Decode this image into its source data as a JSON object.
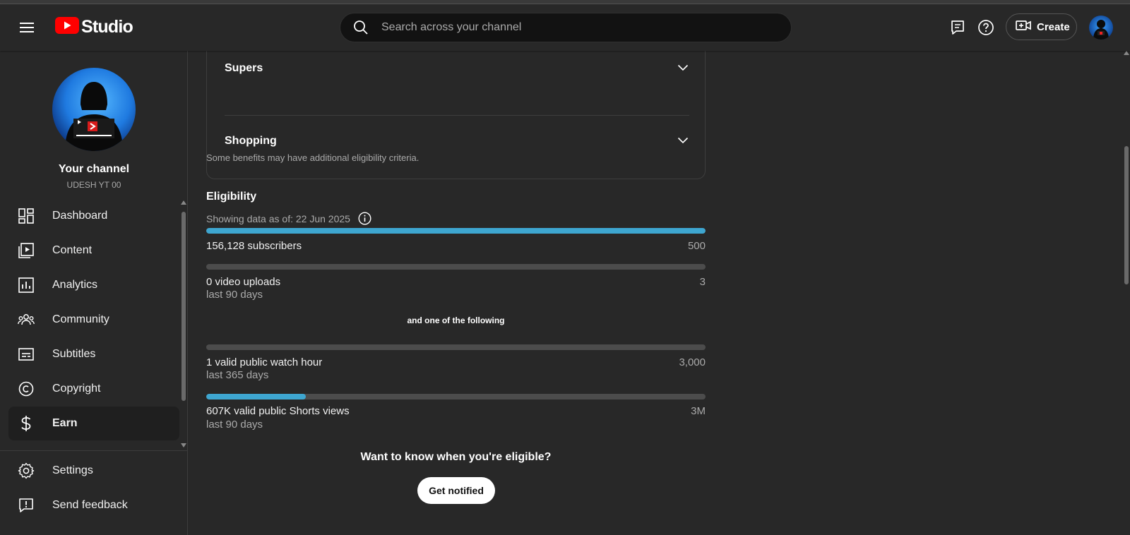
{
  "header": {
    "app_name": "Studio",
    "search_placeholder": "Search across your channel",
    "create_label": "Create"
  },
  "sidebar": {
    "channel_title": "Your channel",
    "channel_name": "UDESH YT 00",
    "items": [
      {
        "label": "Dashboard",
        "icon": "dashboard-icon"
      },
      {
        "label": "Content",
        "icon": "content-icon"
      },
      {
        "label": "Analytics",
        "icon": "analytics-icon"
      },
      {
        "label": "Community",
        "icon": "community-icon"
      },
      {
        "label": "Subtitles",
        "icon": "subtitles-icon"
      },
      {
        "label": "Copyright",
        "icon": "copyright-icon"
      },
      {
        "label": "Earn",
        "icon": "dollar-icon",
        "active": true
      }
    ],
    "footer_items": [
      {
        "label": "Settings",
        "icon": "gear-icon"
      },
      {
        "label": "Send feedback",
        "icon": "feedback-icon"
      }
    ]
  },
  "benefits": {
    "sections": [
      {
        "label": "Supers"
      },
      {
        "label": "Shopping"
      }
    ],
    "note": "Some benefits may have additional eligibility criteria."
  },
  "eligibility": {
    "title": "Eligibility",
    "as_of": "Showing data as of: 22 Jun 2025",
    "metrics": [
      {
        "label": "156,128 subscribers",
        "sub": "",
        "target": "500",
        "progress": 1.0
      },
      {
        "label": "0 video uploads",
        "sub": "last 90 days",
        "target": "3",
        "progress": 0.0
      }
    ],
    "or_text": "and one of the following",
    "alt_metrics": [
      {
        "label": "1 valid public watch hour",
        "sub": "last 365 days",
        "target": "3,000",
        "progress": 0.0
      },
      {
        "label": "607K valid public Shorts views",
        "sub": "last 90 days",
        "target": "3M",
        "progress": 0.2
      }
    ],
    "cta_text": "Want to know when you're eligible?",
    "cta_button": "Get notified"
  },
  "colors": {
    "background": "#282828",
    "progress_fill": "#3ea6d0",
    "progress_track": "#4c4c4c",
    "brand_red": "#ff0000"
  }
}
